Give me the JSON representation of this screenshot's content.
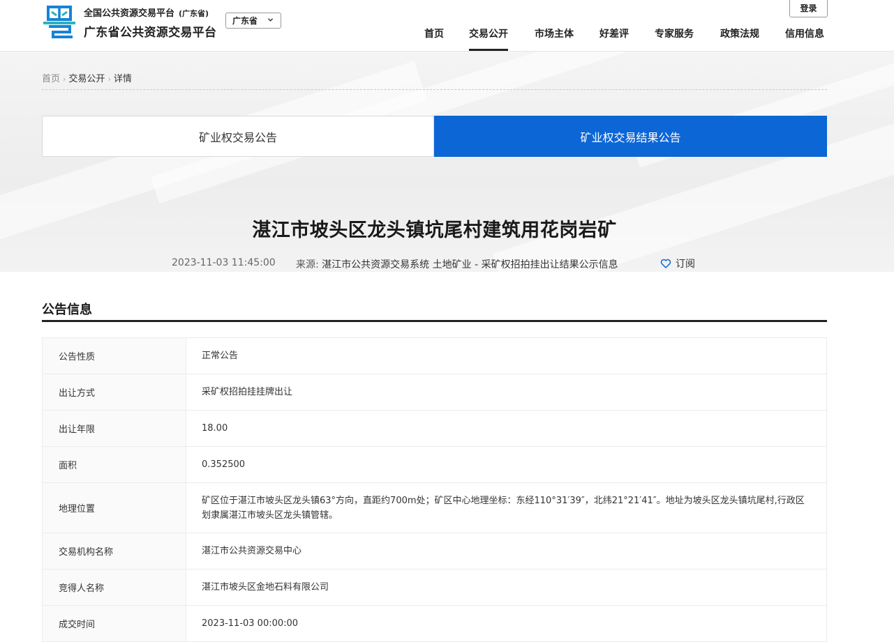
{
  "header": {
    "brand_top": "全国公共资源交易平台",
    "brand_top_province": "(广东省)",
    "brand_main": "广东省公共资源交易平台",
    "region_select": "广东省",
    "login_label": "登录",
    "nav": [
      {
        "label": "首页"
      },
      {
        "label": "交易公开",
        "active": true
      },
      {
        "label": "市场主体"
      },
      {
        "label": "好差评"
      },
      {
        "label": "专家服务"
      },
      {
        "label": "政策法规"
      },
      {
        "label": "信用信息"
      }
    ]
  },
  "breadcrumb": {
    "home": "首页",
    "level2": "交易公开",
    "current": "详情"
  },
  "tabs": [
    {
      "label": "矿业权交易公告",
      "active": false
    },
    {
      "label": "矿业权交易结果公告",
      "active": true
    }
  ],
  "article": {
    "title": "湛江市坡头区龙头镇坑尾村建筑用花岗岩矿",
    "date": "2023-11-03 11:45:00",
    "source_label": "来源:",
    "source_value": "湛江市公共资源交易系统 土地矿业 - 采矿权招拍挂出让结果公示信息",
    "subscribe_label": "订阅"
  },
  "section": {
    "title": "公告信息",
    "rows": [
      {
        "key": "公告性质",
        "value": "正常公告"
      },
      {
        "key": "出让方式",
        "value": "采矿权招拍挂挂牌出让"
      },
      {
        "key": "出让年限",
        "value": "18.00"
      },
      {
        "key": "面积",
        "value": "0.352500"
      },
      {
        "key": "地理位置",
        "value": "矿区位于湛江市坡头区龙头镇63°方向，直距约700m处；矿区中心地理坐标：东经110°31′39″，北纬21°21′41″。地址为坡头区龙头镇坑尾村,行政区划隶属湛江市坡头区龙头镇管辖。"
      },
      {
        "key": "交易机构名称",
        "value": "湛江市公共资源交易中心"
      },
      {
        "key": "竞得人名称",
        "value": "湛江市坡头区金地石料有限公司"
      },
      {
        "key": "成交时间",
        "value": "2023-11-03 00:00:00"
      }
    ]
  },
  "colors": {
    "accent": "#0c66d6",
    "logo_blue": "#1683d6",
    "logo_teal": "#2bb3c0"
  }
}
